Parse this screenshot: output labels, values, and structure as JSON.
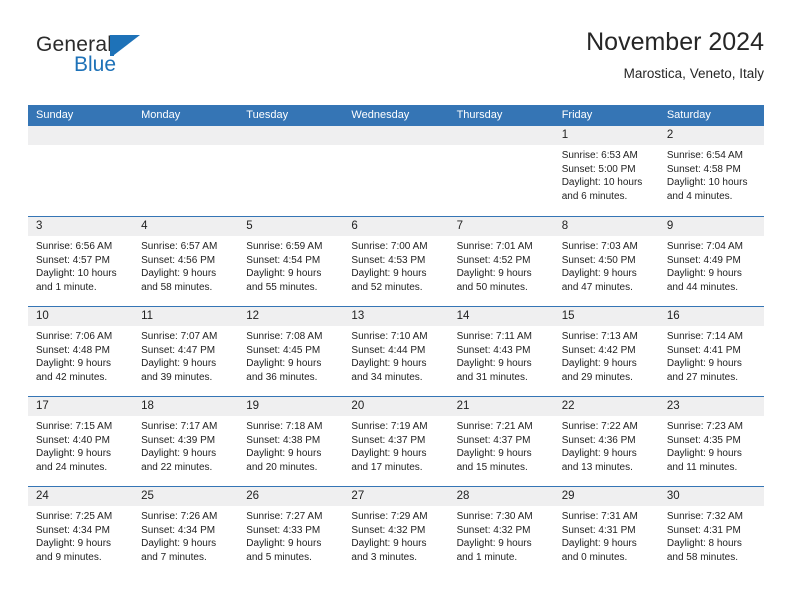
{
  "brand": {
    "word_general": "General",
    "word_blue": "Blue",
    "flag_color": "#1e72b8"
  },
  "header": {
    "title": "November 2024",
    "subtitle": "Marostica, Veneto, Italy"
  },
  "theme": {
    "header_bar_color": "#3575b5",
    "daynum_strip_color": "#efeff0",
    "row_divider_color": "#3575b5",
    "text_color": "#1f1f1f"
  },
  "weekdays": [
    "Sunday",
    "Monday",
    "Tuesday",
    "Wednesday",
    "Thursday",
    "Friday",
    "Saturday"
  ],
  "labels": {
    "sunrise_prefix": "Sunrise:",
    "sunset_prefix": "Sunset:",
    "daylight_prefix": "Daylight:"
  },
  "weeks": [
    [
      {
        "day": "",
        "empty": true
      },
      {
        "day": "",
        "empty": true
      },
      {
        "day": "",
        "empty": true
      },
      {
        "day": "",
        "empty": true
      },
      {
        "day": "",
        "empty": true
      },
      {
        "day": "1",
        "sunrise": "Sunrise: 6:53 AM",
        "sunset": "Sunset: 5:00 PM",
        "daylight": "Daylight: 10 hours and 6 minutes."
      },
      {
        "day": "2",
        "sunrise": "Sunrise: 6:54 AM",
        "sunset": "Sunset: 4:58 PM",
        "daylight": "Daylight: 10 hours and 4 minutes."
      }
    ],
    [
      {
        "day": "3",
        "sunrise": "Sunrise: 6:56 AM",
        "sunset": "Sunset: 4:57 PM",
        "daylight": "Daylight: 10 hours and 1 minute."
      },
      {
        "day": "4",
        "sunrise": "Sunrise: 6:57 AM",
        "sunset": "Sunset: 4:56 PM",
        "daylight": "Daylight: 9 hours and 58 minutes."
      },
      {
        "day": "5",
        "sunrise": "Sunrise: 6:59 AM",
        "sunset": "Sunset: 4:54 PM",
        "daylight": "Daylight: 9 hours and 55 minutes."
      },
      {
        "day": "6",
        "sunrise": "Sunrise: 7:00 AM",
        "sunset": "Sunset: 4:53 PM",
        "daylight": "Daylight: 9 hours and 52 minutes."
      },
      {
        "day": "7",
        "sunrise": "Sunrise: 7:01 AM",
        "sunset": "Sunset: 4:52 PM",
        "daylight": "Daylight: 9 hours and 50 minutes."
      },
      {
        "day": "8",
        "sunrise": "Sunrise: 7:03 AM",
        "sunset": "Sunset: 4:50 PM",
        "daylight": "Daylight: 9 hours and 47 minutes."
      },
      {
        "day": "9",
        "sunrise": "Sunrise: 7:04 AM",
        "sunset": "Sunset: 4:49 PM",
        "daylight": "Daylight: 9 hours and 44 minutes."
      }
    ],
    [
      {
        "day": "10",
        "sunrise": "Sunrise: 7:06 AM",
        "sunset": "Sunset: 4:48 PM",
        "daylight": "Daylight: 9 hours and 42 minutes."
      },
      {
        "day": "11",
        "sunrise": "Sunrise: 7:07 AM",
        "sunset": "Sunset: 4:47 PM",
        "daylight": "Daylight: 9 hours and 39 minutes."
      },
      {
        "day": "12",
        "sunrise": "Sunrise: 7:08 AM",
        "sunset": "Sunset: 4:45 PM",
        "daylight": "Daylight: 9 hours and 36 minutes."
      },
      {
        "day": "13",
        "sunrise": "Sunrise: 7:10 AM",
        "sunset": "Sunset: 4:44 PM",
        "daylight": "Daylight: 9 hours and 34 minutes."
      },
      {
        "day": "14",
        "sunrise": "Sunrise: 7:11 AM",
        "sunset": "Sunset: 4:43 PM",
        "daylight": "Daylight: 9 hours and 31 minutes."
      },
      {
        "day": "15",
        "sunrise": "Sunrise: 7:13 AM",
        "sunset": "Sunset: 4:42 PM",
        "daylight": "Daylight: 9 hours and 29 minutes."
      },
      {
        "day": "16",
        "sunrise": "Sunrise: 7:14 AM",
        "sunset": "Sunset: 4:41 PM",
        "daylight": "Daylight: 9 hours and 27 minutes."
      }
    ],
    [
      {
        "day": "17",
        "sunrise": "Sunrise: 7:15 AM",
        "sunset": "Sunset: 4:40 PM",
        "daylight": "Daylight: 9 hours and 24 minutes."
      },
      {
        "day": "18",
        "sunrise": "Sunrise: 7:17 AM",
        "sunset": "Sunset: 4:39 PM",
        "daylight": "Daylight: 9 hours and 22 minutes."
      },
      {
        "day": "19",
        "sunrise": "Sunrise: 7:18 AM",
        "sunset": "Sunset: 4:38 PM",
        "daylight": "Daylight: 9 hours and 20 minutes."
      },
      {
        "day": "20",
        "sunrise": "Sunrise: 7:19 AM",
        "sunset": "Sunset: 4:37 PM",
        "daylight": "Daylight: 9 hours and 17 minutes."
      },
      {
        "day": "21",
        "sunrise": "Sunrise: 7:21 AM",
        "sunset": "Sunset: 4:37 PM",
        "daylight": "Daylight: 9 hours and 15 minutes."
      },
      {
        "day": "22",
        "sunrise": "Sunrise: 7:22 AM",
        "sunset": "Sunset: 4:36 PM",
        "daylight": "Daylight: 9 hours and 13 minutes."
      },
      {
        "day": "23",
        "sunrise": "Sunrise: 7:23 AM",
        "sunset": "Sunset: 4:35 PM",
        "daylight": "Daylight: 9 hours and 11 minutes."
      }
    ],
    [
      {
        "day": "24",
        "sunrise": "Sunrise: 7:25 AM",
        "sunset": "Sunset: 4:34 PM",
        "daylight": "Daylight: 9 hours and 9 minutes."
      },
      {
        "day": "25",
        "sunrise": "Sunrise: 7:26 AM",
        "sunset": "Sunset: 4:34 PM",
        "daylight": "Daylight: 9 hours and 7 minutes."
      },
      {
        "day": "26",
        "sunrise": "Sunrise: 7:27 AM",
        "sunset": "Sunset: 4:33 PM",
        "daylight": "Daylight: 9 hours and 5 minutes."
      },
      {
        "day": "27",
        "sunrise": "Sunrise: 7:29 AM",
        "sunset": "Sunset: 4:32 PM",
        "daylight": "Daylight: 9 hours and 3 minutes."
      },
      {
        "day": "28",
        "sunrise": "Sunrise: 7:30 AM",
        "sunset": "Sunset: 4:32 PM",
        "daylight": "Daylight: 9 hours and 1 minute."
      },
      {
        "day": "29",
        "sunrise": "Sunrise: 7:31 AM",
        "sunset": "Sunset: 4:31 PM",
        "daylight": "Daylight: 9 hours and 0 minutes."
      },
      {
        "day": "30",
        "sunrise": "Sunrise: 7:32 AM",
        "sunset": "Sunset: 4:31 PM",
        "daylight": "Daylight: 8 hours and 58 minutes."
      }
    ]
  ]
}
